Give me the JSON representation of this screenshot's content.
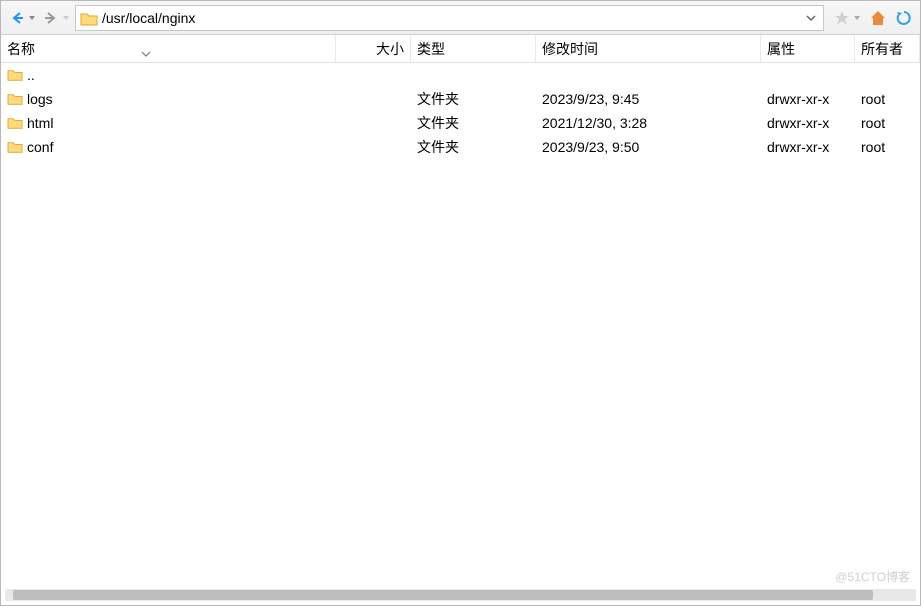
{
  "path": "/usr/local/nginx",
  "columns": {
    "name": "名称",
    "size": "大小",
    "type": "类型",
    "modified": "修改时间",
    "attrs": "属性",
    "owner": "所有者"
  },
  "rows": [
    {
      "name": "..",
      "size": "",
      "type": "",
      "modified": "",
      "attrs": "",
      "owner": ""
    },
    {
      "name": "logs",
      "size": "",
      "type": "文件夹",
      "modified": "2023/9/23, 9:45",
      "attrs": "drwxr-xr-x",
      "owner": "root"
    },
    {
      "name": "html",
      "size": "",
      "type": "文件夹",
      "modified": "2021/12/30, 3:28",
      "attrs": "drwxr-xr-x",
      "owner": "root"
    },
    {
      "name": "conf",
      "size": "",
      "type": "文件夹",
      "modified": "2023/9/23, 9:50",
      "attrs": "drwxr-xr-x",
      "owner": "root"
    }
  ],
  "watermark": "@51CTO博客"
}
